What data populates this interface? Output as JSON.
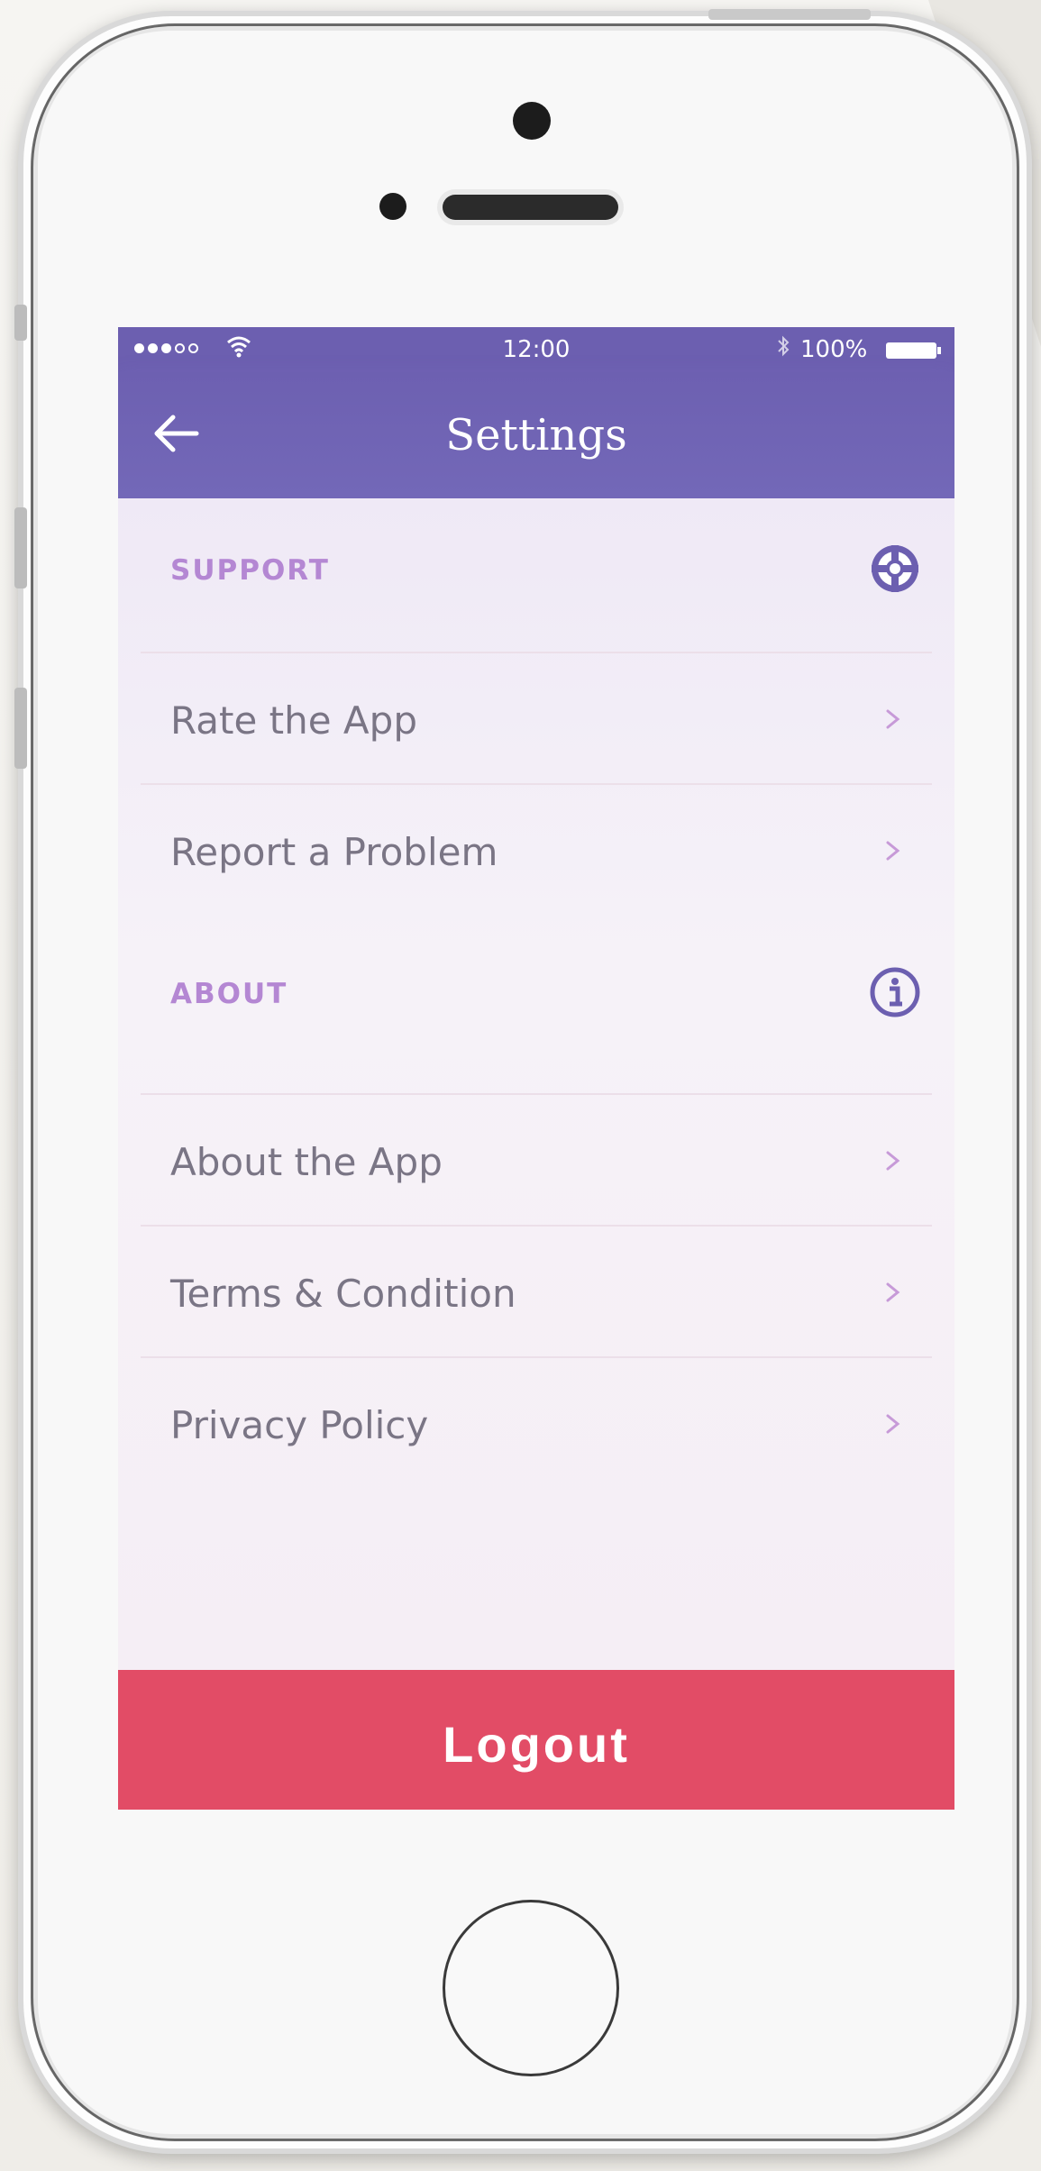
{
  "status_bar": {
    "time": "12:00",
    "battery": "100%",
    "signal_icon": "signal-dots-icon",
    "wifi_icon": "wifi-icon",
    "bluetooth_icon": "bluetooth-icon",
    "battery_icon": "battery-full-icon"
  },
  "nav": {
    "title": "Settings",
    "back_icon": "arrow-left-icon"
  },
  "sections": [
    {
      "label": "SUPPORT",
      "icon": "lifebuoy-icon",
      "items": [
        {
          "label": "Rate the App"
        },
        {
          "label": "Report a Problem"
        }
      ]
    },
    {
      "label": "ABOUT",
      "icon": "info-icon",
      "items": [
        {
          "label": "About the App"
        },
        {
          "label": "Terms & Condition"
        },
        {
          "label": "Privacy Policy"
        }
      ]
    }
  ],
  "logout": {
    "label": "Logout"
  },
  "colors": {
    "header": "#6c5fb0",
    "section_label": "#b487d3",
    "logout": "#e24c66",
    "item_text": "#7a7585"
  }
}
